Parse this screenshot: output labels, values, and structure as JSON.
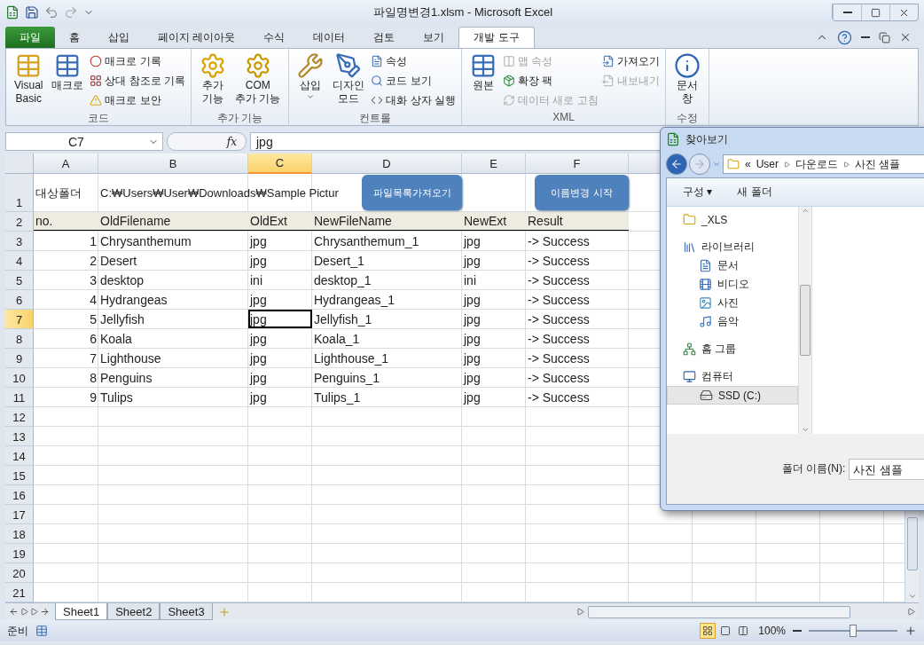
{
  "window": {
    "title": "파일명변경1.xlsm - Microsoft Excel"
  },
  "ribbon_tabs": [
    {
      "label": "파일",
      "kind": "file",
      "selected": false
    },
    {
      "label": "홈",
      "kind": "tab",
      "selected": false
    },
    {
      "label": "삽입",
      "kind": "tab",
      "selected": false
    },
    {
      "label": "페이지 레이아웃",
      "kind": "tab",
      "selected": false
    },
    {
      "label": "수식",
      "kind": "tab",
      "selected": false
    },
    {
      "label": "데이터",
      "kind": "tab",
      "selected": false
    },
    {
      "label": "검토",
      "kind": "tab",
      "selected": false
    },
    {
      "label": "보기",
      "kind": "tab",
      "selected": false
    },
    {
      "label": "개발 도구",
      "kind": "tab",
      "selected": true
    }
  ],
  "ribbon_groups": [
    {
      "label": "코드",
      "items": [
        {
          "kind": "large",
          "label": "Visual\nBasic"
        },
        {
          "kind": "large",
          "label": "매크로"
        },
        {
          "kind": "stack",
          "items": [
            {
              "label": "매크로 기록",
              "disabled": false
            },
            {
              "label": "상대 참조로 기록",
              "disabled": false
            },
            {
              "label": "매크로 보안",
              "disabled": false
            }
          ]
        }
      ]
    },
    {
      "label": "추가 기능",
      "items": [
        {
          "kind": "large",
          "label": "추가\n기능"
        },
        {
          "kind": "large",
          "label": "COM\n추가 기능"
        }
      ]
    },
    {
      "label": "컨트롤",
      "items": [
        {
          "kind": "dropdown",
          "label": "삽입"
        },
        {
          "kind": "large",
          "label": "디자인\n모드"
        },
        {
          "kind": "stack",
          "items": [
            {
              "label": "속성",
              "disabled": false
            },
            {
              "label": "코드 보기",
              "disabled": false
            },
            {
              "label": "대화 상자 실행",
              "disabled": false
            }
          ]
        }
      ]
    },
    {
      "label": "XML",
      "items": [
        {
          "kind": "large",
          "label": "원본"
        },
        {
          "kind": "stack",
          "items": [
            {
              "label": "맵 속성",
              "disabled": true
            },
            {
              "label": "확장 팩",
              "disabled": false
            },
            {
              "label": "데이터 새로 고침",
              "disabled": true
            }
          ]
        },
        {
          "kind": "stack",
          "items": [
            {
              "label": "가져오기",
              "disabled": false
            },
            {
              "label": "내보내기",
              "disabled": true
            }
          ]
        }
      ]
    },
    {
      "label": "수정",
      "items": [
        {
          "kind": "large",
          "label": "문서\n창"
        }
      ]
    }
  ],
  "formula_bar": {
    "name_box": "C7",
    "fx": "fx",
    "value": "jpg"
  },
  "sheet": {
    "columns": [
      {
        "label": "A",
        "selected": false
      },
      {
        "label": "B",
        "selected": false
      },
      {
        "label": "C",
        "selected": true
      },
      {
        "label": "D",
        "selected": false
      },
      {
        "label": "E",
        "selected": false
      },
      {
        "label": "F",
        "selected": false
      }
    ],
    "rows": [
      {
        "label": "1",
        "kind": "title",
        "selected": false,
        "cells": [
          "대상폴더",
          "C:₩Users₩User₩Downloads₩Sample Pictur"
        ]
      },
      {
        "label": "2",
        "kind": "header",
        "selected": false,
        "cells": [
          "no.",
          "OldFilename",
          "OldExt",
          "NewFileName",
          "NewExt",
          "Result"
        ]
      },
      {
        "label": "3",
        "kind": "data",
        "selected": false,
        "cells": [
          "1",
          "Chrysanthemum",
          "jpg",
          "Chrysanthemum_1",
          "jpg",
          "-> Success"
        ]
      },
      {
        "label": "4",
        "kind": "data",
        "selected": false,
        "cells": [
          "2",
          "Desert",
          "jpg",
          "Desert_1",
          "jpg",
          "-> Success"
        ]
      },
      {
        "label": "5",
        "kind": "data",
        "selected": false,
        "cells": [
          "3",
          "desktop",
          "ini",
          "desktop_1",
          "ini",
          "-> Success"
        ]
      },
      {
        "label": "6",
        "kind": "data",
        "selected": false,
        "cells": [
          "4",
          "Hydrangeas",
          "jpg",
          "Hydrangeas_1",
          "jpg",
          "-> Success"
        ]
      },
      {
        "label": "7",
        "kind": "data",
        "selected": true,
        "cells": [
          "5",
          "Jellyfish",
          "jpg",
          "Jellyfish_1",
          "jpg",
          "-> Success"
        ]
      },
      {
        "label": "8",
        "kind": "data",
        "selected": false,
        "cells": [
          "6",
          "Koala",
          "jpg",
          "Koala_1",
          "jpg",
          "-> Success"
        ]
      },
      {
        "label": "9",
        "kind": "data",
        "selected": false,
        "cells": [
          "7",
          "Lighthouse",
          "jpg",
          "Lighthouse_1",
          "jpg",
          "-> Success"
        ]
      },
      {
        "label": "10",
        "kind": "data",
        "selected": false,
        "cells": [
          "8",
          "Penguins",
          "jpg",
          "Penguins_1",
          "jpg",
          "-> Success"
        ]
      },
      {
        "label": "11",
        "kind": "data",
        "selected": false,
        "cells": [
          "9",
          "Tulips",
          "jpg",
          "Tulips_1",
          "jpg",
          "-> Success"
        ]
      },
      {
        "label": "12",
        "kind": "data",
        "selected": false
      },
      {
        "label": "13",
        "kind": "data",
        "selected": false
      },
      {
        "label": "14",
        "kind": "data",
        "selected": false
      },
      {
        "label": "15",
        "kind": "data",
        "selected": false
      },
      {
        "label": "16",
        "kind": "data",
        "selected": false
      },
      {
        "label": "17",
        "kind": "data",
        "selected": false
      },
      {
        "label": "18",
        "kind": "data",
        "selected": false
      },
      {
        "label": "19",
        "kind": "data",
        "selected": false
      },
      {
        "label": "20",
        "kind": "data",
        "selected": false
      },
      {
        "label": "21",
        "kind": "data",
        "selected": false
      }
    ],
    "buttons": [
      {
        "label": "파일목록가져오기"
      },
      {
        "label": "이름변경 시작"
      }
    ]
  },
  "sheet_tabs": [
    {
      "label": "Sheet1",
      "selected": true
    },
    {
      "label": "Sheet2",
      "selected": false
    },
    {
      "label": "Sheet3",
      "selected": false
    }
  ],
  "status_bar": {
    "status": "준비",
    "views": [
      {
        "selected": true
      },
      {
        "selected": false
      },
      {
        "selected": false
      }
    ],
    "zoom": "100%",
    "zoom_level": {
      "level": 0.5
    }
  },
  "dialog": {
    "title": "찾아보기",
    "breadcrumb": [
      "«",
      "User",
      "다운로드",
      "사진 샘플"
    ],
    "toolbar": [
      "구성 ▾",
      "새 폴더"
    ],
    "tree": [
      {
        "label": "_XLS",
        "selected": false
      },
      {
        "label": "라이브러리",
        "selected": false,
        "children": [
          {
            "label": "문서",
            "selected": false
          },
          {
            "label": "비디오",
            "selected": false
          },
          {
            "label": "사진",
            "selected": false
          },
          {
            "label": "음악",
            "selected": false
          }
        ]
      },
      {
        "label": "홈 그룹",
        "selected": false
      },
      {
        "label": "컴퓨터",
        "selected": false,
        "children": [
          {
            "label": "SSD (C:)",
            "selected": true
          }
        ]
      }
    ],
    "folder_label": "폴더 이름(N):",
    "folder_value": "사진 샘플"
  }
}
